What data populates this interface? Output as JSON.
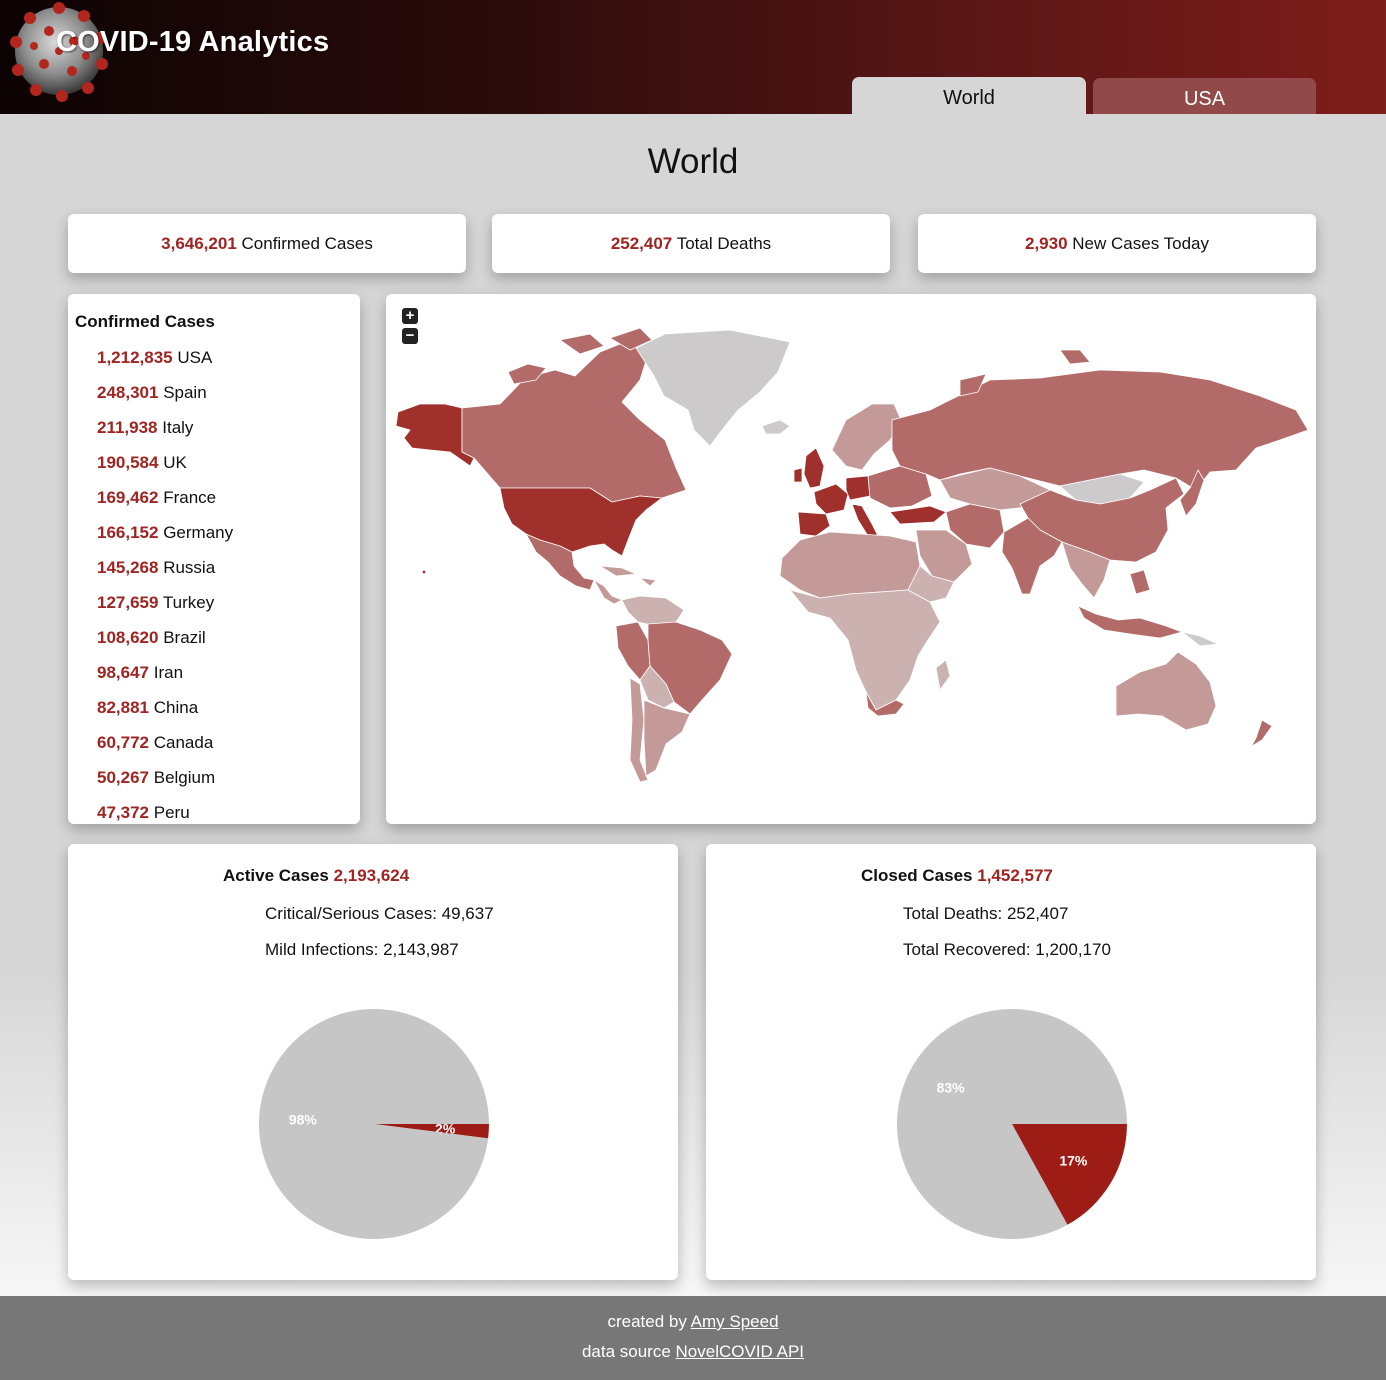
{
  "header": {
    "title": "COVID-19 Analytics",
    "logo_icon": "coronavirus-icon",
    "tabs": [
      {
        "label": "World",
        "active": true
      },
      {
        "label": "USA",
        "active": false
      }
    ]
  },
  "page_title": "World",
  "stats": [
    {
      "value": "3,646,201",
      "label": "Confirmed Cases"
    },
    {
      "value": "252,407",
      "label": "Total Deaths"
    },
    {
      "value": "2,930",
      "label": "New Cases Today"
    }
  ],
  "confirmed_list": {
    "title": "Confirmed Cases",
    "items": [
      {
        "value": "1,212,835",
        "country": "USA"
      },
      {
        "value": "248,301",
        "country": "Spain"
      },
      {
        "value": "211,938",
        "country": "Italy"
      },
      {
        "value": "190,584",
        "country": "UK"
      },
      {
        "value": "169,462",
        "country": "France"
      },
      {
        "value": "166,152",
        "country": "Germany"
      },
      {
        "value": "145,268",
        "country": "Russia"
      },
      {
        "value": "127,659",
        "country": "Turkey"
      },
      {
        "value": "108,620",
        "country": "Brazil"
      },
      {
        "value": "98,647",
        "country": "Iran"
      },
      {
        "value": "82,881",
        "country": "China"
      },
      {
        "value": "60,772",
        "country": "Canada"
      },
      {
        "value": "50,267",
        "country": "Belgium"
      },
      {
        "value": "47,372",
        "country": "Peru"
      }
    ]
  },
  "map": {
    "zoom_in": "+",
    "zoom_out": "−",
    "colors": {
      "high": "#a0302b",
      "mid": "#b26b69",
      "low": "#c49a99",
      "lower": "#cbb2b1",
      "none": "#cccaca"
    }
  },
  "active_cases": {
    "heading_label": "Active Cases",
    "heading_value": "2,193,624",
    "line1": "Critical/Serious Cases: 49,637",
    "line2": "Mild Infections: 2,143,987"
  },
  "closed_cases": {
    "heading_label": "Closed Cases",
    "heading_value": "1,452,577",
    "line1": "Total Deaths: 252,407",
    "line2": "Total Recovered: 1,200,170"
  },
  "chart_data": [
    {
      "type": "pie",
      "slices": [
        {
          "name": "Critical/Serious Cases",
          "value": 2,
          "label": "2%",
          "color": "#9d1d16"
        },
        {
          "name": "Mild Infections",
          "value": 98,
          "label": "98%",
          "color": "#c6c6c6"
        }
      ]
    },
    {
      "type": "pie",
      "slices": [
        {
          "name": "Total Deaths",
          "value": 17,
          "label": "17%",
          "color": "#9d1d16"
        },
        {
          "name": "Total Recovered",
          "value": 83,
          "label": "83%",
          "color": "#c6c6c6"
        }
      ]
    }
  ],
  "footer": {
    "created_prefix": "created by",
    "author": "Amy Speed",
    "source_prefix": "data source",
    "source": "NovelCOVID API"
  }
}
